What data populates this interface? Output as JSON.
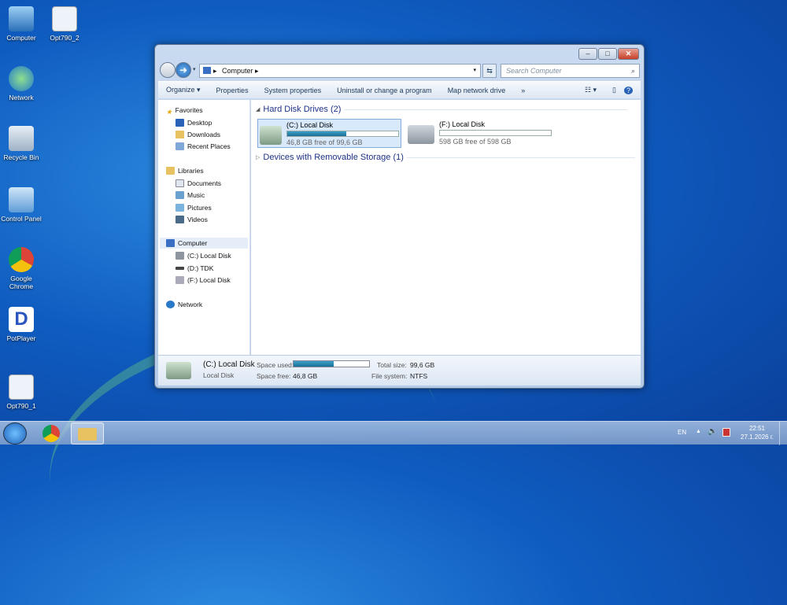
{
  "desktop": {
    "icons": [
      {
        "label": "Computer"
      },
      {
        "label": "Opt790_2"
      },
      {
        "label": "Network"
      },
      {
        "label": "Recycle Bin"
      },
      {
        "label": "Control Panel"
      },
      {
        "label": "Google Chrome"
      },
      {
        "label": "PotPlayer"
      },
      {
        "label": "Opt790_1"
      }
    ]
  },
  "window": {
    "address": {
      "path": "Computer",
      "search_placeholder": "Search Computer"
    },
    "toolbar": {
      "organize": "Organize ▾",
      "properties": "Properties",
      "system_properties": "System properties",
      "uninstall": "Uninstall or change a program",
      "map_drive": "Map network drive",
      "more": "»"
    },
    "nav": {
      "favorites": "Favorites",
      "desktop": "Desktop",
      "downloads": "Downloads",
      "recent": "Recent Places",
      "libraries": "Libraries",
      "documents": "Documents",
      "music": "Music",
      "pictures": "Pictures",
      "videos": "Videos",
      "computer": "Computer",
      "c": "(C:) Local Disk",
      "d": "(D:) TDK",
      "f": "(F:) Local Disk",
      "network": "Network"
    },
    "content": {
      "hdd_group": "Hard Disk Drives (2)",
      "removable_group": "Devices with Removable Storage (1)",
      "drives": [
        {
          "name": "(C:) Local Disk",
          "free": "46,8 GB free of 99,6 GB",
          "used_fraction": 0.53
        },
        {
          "name": "(F:) Local Disk",
          "free": "598 GB free of 598 GB",
          "used_fraction": 0.0
        }
      ]
    },
    "details": {
      "name": "(C:) Local Disk",
      "type": "Local Disk",
      "space_used_label": "Space used:",
      "space_free_label": "Space free:",
      "space_free": "46,8 GB",
      "total_label": "Total size:",
      "total": "99,6 GB",
      "fs_label": "File system:",
      "fs": "NTFS",
      "used_fraction": 0.53
    }
  },
  "taskbar": {
    "lang": "EN",
    "time": "22:51",
    "date": "27.1.2026 г."
  }
}
